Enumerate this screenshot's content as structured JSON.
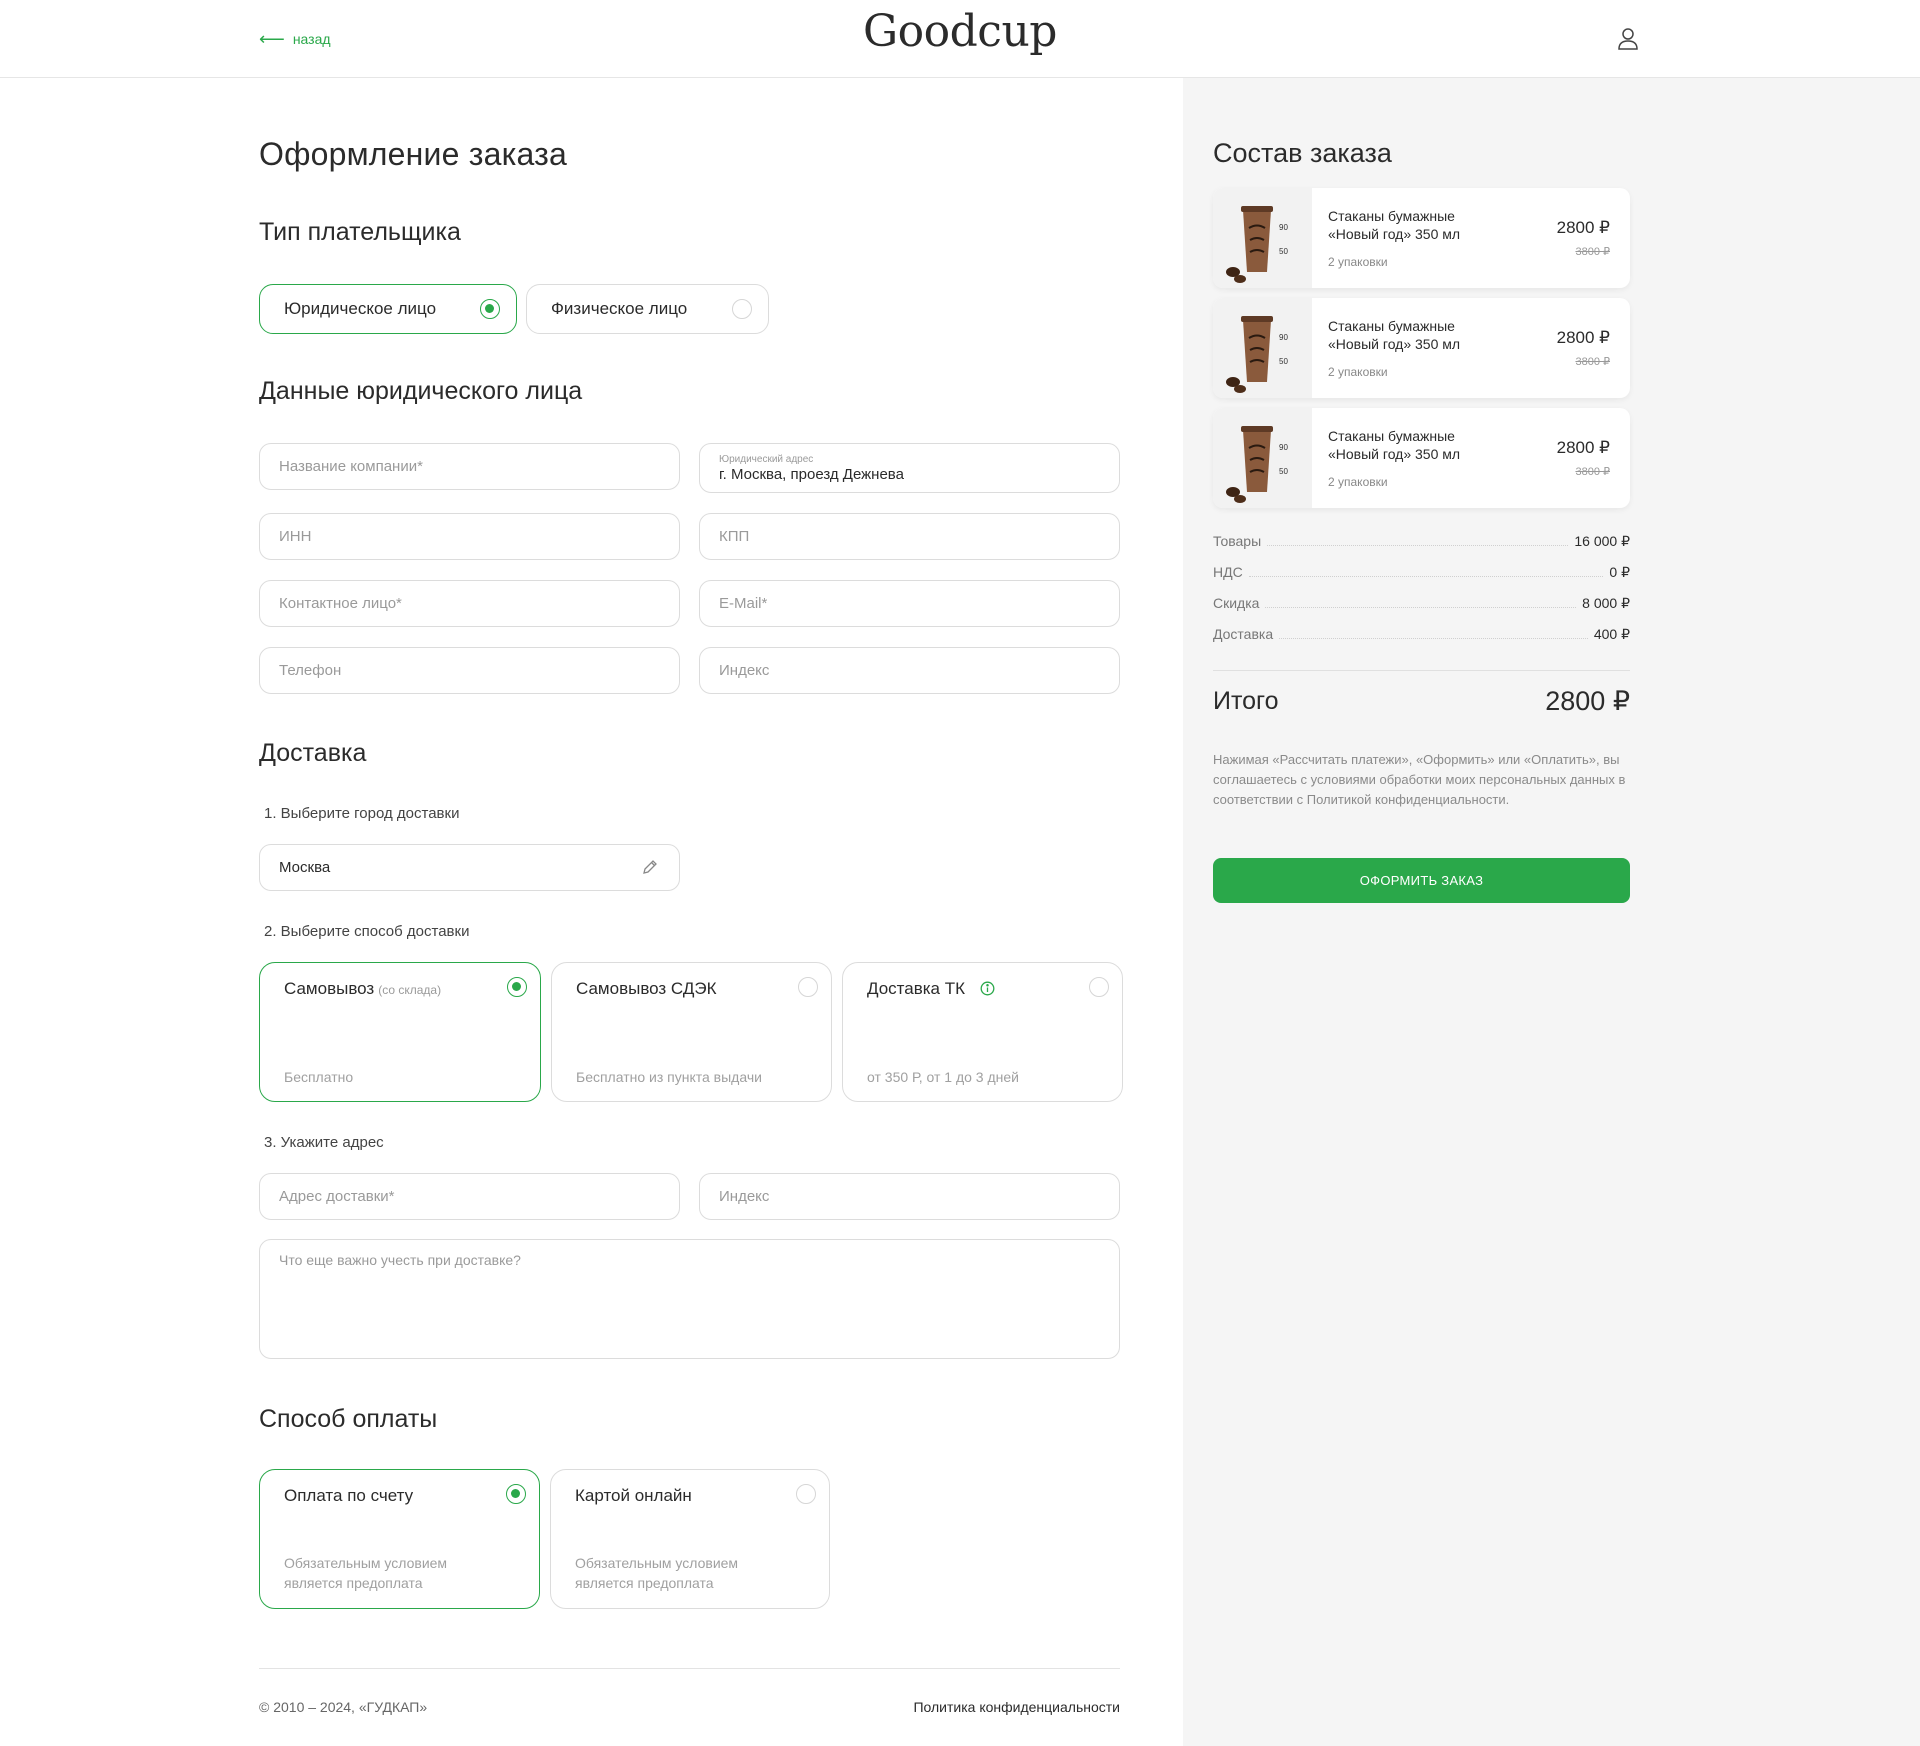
{
  "header": {
    "back_label": "назад",
    "logo": "Goodcup"
  },
  "page_title": "Оформление заказа",
  "payer_type": {
    "heading": "Тип плательщика",
    "options": [
      {
        "label": "Юридическое лицо",
        "selected": true
      },
      {
        "label": "Физическое лицо",
        "selected": false
      }
    ]
  },
  "legal_entity": {
    "heading": "Данные юридического лица",
    "company_name_placeholder": "Название компании*",
    "legal_address_label": "Юридический адрес",
    "legal_address_value": "г. Москва, проезд Дежнева",
    "inn_placeholder": "ИНН",
    "kpp_placeholder": "КПП",
    "contact_placeholder": "Контактное лицо*",
    "email_placeholder": "E-Mail*",
    "phone_placeholder": "Телефон",
    "index_placeholder": "Индекс"
  },
  "delivery": {
    "heading": "Доставка",
    "step1": "1. Выберите город доставки",
    "city_value": "Москва",
    "step2": "2. Выберите способ доставки",
    "methods": [
      {
        "title": "Самовывоз",
        "note": "(со склада)",
        "desc": "Бесплатно",
        "selected": true
      },
      {
        "title": "Самовывоз СДЭК",
        "note": "",
        "desc": "Бесплатно из пункта выдачи",
        "selected": false
      },
      {
        "title": "Доставка ТК",
        "note": "",
        "desc": "от 350 Р, от 1 до 3 дней",
        "selected": false
      }
    ],
    "step3": "3. Укажите адрес",
    "address_placeholder": "Адрес доставки*",
    "index_placeholder": "Индекс",
    "comment_placeholder": "Что еще важно учесть при доставке?"
  },
  "payment": {
    "heading": "Способ оплаты",
    "methods": [
      {
        "title": "Оплата по счету",
        "desc1": "Обязательным условием",
        "desc2": "является предоплата",
        "selected": true
      },
      {
        "title": "Картой онлайн",
        "desc1": "Обязательным условием",
        "desc2": "является предоплата",
        "selected": false
      }
    ]
  },
  "footer": {
    "copyright": "© 2010 – 2024, «ГУДКАП»",
    "policy": "Политика конфиденциальности"
  },
  "order": {
    "title": "Состав заказа",
    "items": [
      {
        "name": "Стаканы бумажные «Новый год» 350 мл",
        "qty": "2 упаковки",
        "price": "2800 ₽",
        "old_price": "3800 ₽"
      },
      {
        "name": "Стаканы бумажные «Новый год» 350 мл",
        "qty": "2 упаковки",
        "price": "2800 ₽",
        "old_price": "3800 ₽"
      },
      {
        "name": "Стаканы бумажные «Новый год» 350 мл",
        "qty": "2 упаковки",
        "price": "2800 ₽",
        "old_price": "3800 ₽"
      }
    ],
    "summary": [
      {
        "label": "Товары",
        "value": "16 000 ₽"
      },
      {
        "label": "НДС",
        "value": "0 ₽"
      },
      {
        "label": "Скидка",
        "value": "8 000 ₽"
      },
      {
        "label": "Доставка",
        "value": "400 ₽"
      }
    ],
    "total_label": "Итого",
    "total_value": "2800 ₽",
    "consent": "Нажимая «Рассчитать платежи», «Оформить» или «Оплатить», вы соглашаетесь с условиями обработки моих персональных данных в соответствии с Политикой конфиденциальности.",
    "submit_label": "ОФОРМИТЬ ЗАКАЗ"
  },
  "colors": {
    "accent": "#2aa84a",
    "panel_bg": "#f5f5f5"
  }
}
